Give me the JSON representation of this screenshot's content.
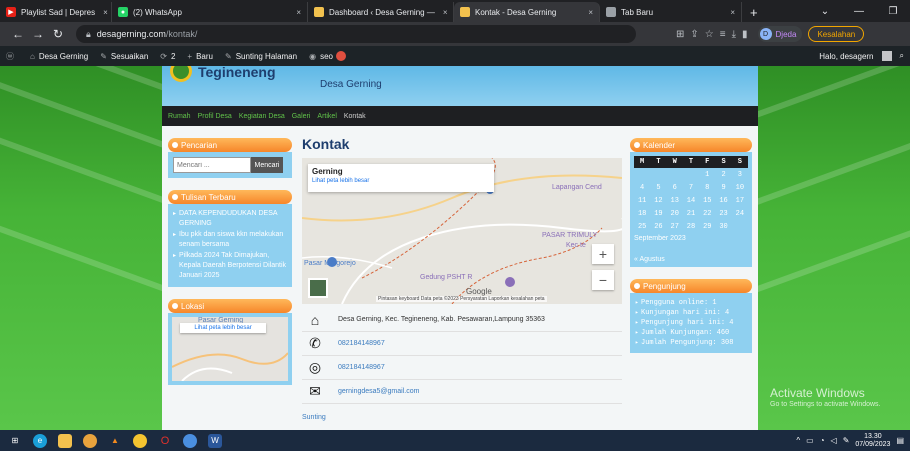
{
  "browser": {
    "tabs": [
      {
        "label": "Playlist Sad | Depres",
        "fav_color": "#e62117",
        "active": false
      },
      {
        "label": "(2) WhatsApp",
        "fav_color": "#25d366",
        "active": false
      },
      {
        "label": "Dashboard ‹ Desa Gerning — ",
        "fav_color": "#f2c14e",
        "active": false
      },
      {
        "label": "Kontak - Desa Gerning",
        "fav_color": "#f2c14e",
        "active": true
      },
      {
        "label": "Tab Baru",
        "fav_color": "#9aa0a6",
        "active": false
      }
    ],
    "url_host": "desagerning.com",
    "url_path": "/kontak/",
    "profile_initial": "D",
    "profile_name": "Djeda",
    "error_label": "Kesalahan"
  },
  "adminbar": {
    "site_name": "Desa Gerning",
    "customize": "Sesuaikan",
    "updates": "2",
    "new": "Baru",
    "edit_page": "Sunting Halaman",
    "seo": "seo",
    "greeting": "Halo, desagern"
  },
  "site": {
    "title": "Tegineneng",
    "subtitle": "Desa Gerning",
    "nav": [
      "Rumah",
      "Profil Desa",
      "Kegiatan Desa",
      "Galeri",
      "Artikel",
      "Kontak"
    ]
  },
  "sidebar_left": {
    "search_title": "Pencarian",
    "search_placeholder": "Mencari ...",
    "search_button": "Mencari",
    "recent_title": "Tulisan Terbaru",
    "recent_posts": [
      "DATA KEPENDUDUKAN DESA GERNING",
      "Ibu pkk dan siswa kkn melakukan senam bersama",
      "Pilkada 2024 Tak Dimajukan, Kepala Daerah Berpotensi Dilantik Januari 2025"
    ],
    "location_title": "Lokasi",
    "mini_map_place": "Pasar Gerning",
    "mini_map_link": "Lihat peta lebih besar"
  },
  "main": {
    "heading": "Kontak",
    "map": {
      "place_name": "Gerning",
      "bigger_link": "Lihat peta lebih besar",
      "labels": [
        "Lapangan Cend",
        "PASAR TRIMULY",
        "Kec te",
        "Pasar Margorejo",
        "Gedung PSHT R"
      ],
      "attribution": "Pintasan keyboard   Data peta ©2023   Persyaratan   Laporkan kesalahan peta",
      "google": "Google"
    },
    "contacts": [
      {
        "icon": "home-icon",
        "glyph": "⌂",
        "text": "Desa Gerning, Kec. Tegineneng, Kab. Pesawaran,Lampung 35363",
        "link": false
      },
      {
        "icon": "phone-icon",
        "glyph": "✆",
        "text": "082184148967",
        "link": true
      },
      {
        "icon": "whatsapp-icon",
        "glyph": "◎",
        "text": "082184148967",
        "link": true
      },
      {
        "icon": "email-icon",
        "glyph": "✉",
        "text": "gerningdesa5@gmail.com",
        "link": true
      }
    ],
    "edit_link": "Sunting"
  },
  "sidebar_right": {
    "calendar_title": "Kalender",
    "weekdays": [
      "M",
      "T",
      "W",
      "T",
      "F",
      "S",
      "S"
    ],
    "weeks": [
      [
        "",
        "",
        "",
        "",
        "1",
        "2",
        "3"
      ],
      [
        "4",
        "5",
        "6",
        "7",
        "8",
        "9",
        "10"
      ],
      [
        "11",
        "12",
        "13",
        "14",
        "15",
        "16",
        "17"
      ],
      [
        "18",
        "19",
        "20",
        "21",
        "22",
        "23",
        "24"
      ],
      [
        "25",
        "26",
        "27",
        "28",
        "29",
        "30",
        ""
      ]
    ],
    "month": "September 2023",
    "prev_link": "« Agustus",
    "visitors_title": "Pengunjung",
    "stats": [
      "Pengguna online: 1",
      "Kunjungan hari ini: 4",
      "Pengunjung hari ini: 4",
      "Jumlah Kunjungan: 460",
      "Jumlah Pengunjung: 308"
    ]
  },
  "watermark": {
    "line1": "Activate Windows",
    "line2": "Go to Settings to activate Windows."
  },
  "taskbar": {
    "time": "13.30",
    "date": "07/09/2023"
  }
}
